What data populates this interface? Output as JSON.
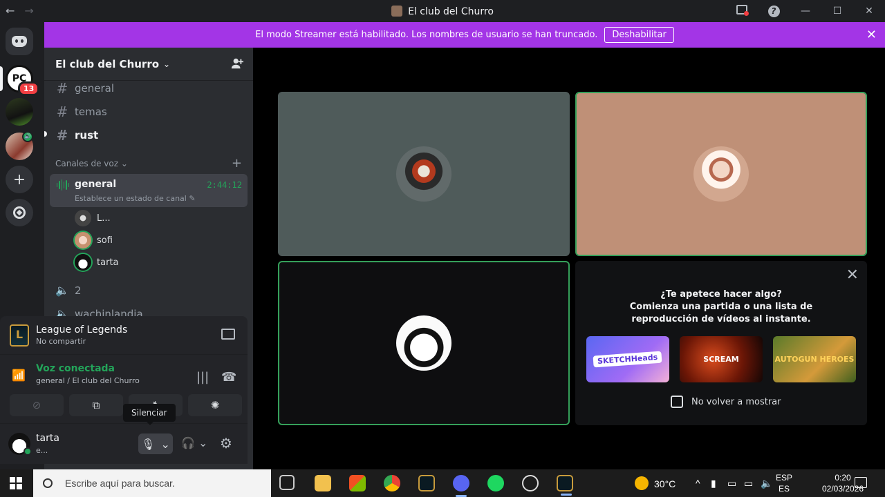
{
  "titlebar": {
    "title": "El club del Churro",
    "back": "←",
    "forward": "→",
    "minimize": "—",
    "maximize": "☐",
    "close": "✕"
  },
  "banner": {
    "text": "El modo Streamer está habilitado. Los nombres de usuario se han truncado.",
    "button": "Deshabilitar"
  },
  "rail": {
    "badge_count": "13",
    "pc_label": "PC"
  },
  "guild": {
    "name": "El club del Churro"
  },
  "channels": {
    "text": [
      {
        "name": "general"
      },
      {
        "name": "temas"
      },
      {
        "name": "rust"
      }
    ],
    "voice_category": "Canales de voz",
    "active_voice": {
      "name": "general",
      "timer": "2:44:12",
      "status": "Establece un estado de canal"
    },
    "members": [
      {
        "name": "L..."
      },
      {
        "name": "sofi"
      },
      {
        "name": "tarta"
      }
    ],
    "other_voice": [
      {
        "name": "2"
      },
      {
        "name": "wachinlandia"
      }
    ]
  },
  "activity": {
    "game": "League of Legends",
    "status": "No compartir"
  },
  "voice_panel": {
    "title": "Voz conectada",
    "location": "general / El club del Churro"
  },
  "user_panel": {
    "name": "tarta",
    "status": "e...",
    "tooltip": "Silenciar"
  },
  "suggest": {
    "title": "¿Te apetece hacer algo?",
    "subtitle": "Comienza una partida o una lista de reproducción de vídeos al instante.",
    "games": [
      {
        "name": "SKETCHHeads"
      },
      {
        "name": "SCREAM"
      },
      {
        "name": "AUTOGUN HEROES"
      }
    ],
    "checkbox_label": "No volver a mostrar"
  },
  "taskbar": {
    "search_placeholder": "Escribe aquí para buscar.",
    "weather": "30°C",
    "lang_top": "ESP",
    "lang_bottom": "ES",
    "time": "0:20",
    "date": "02/03/2026"
  }
}
